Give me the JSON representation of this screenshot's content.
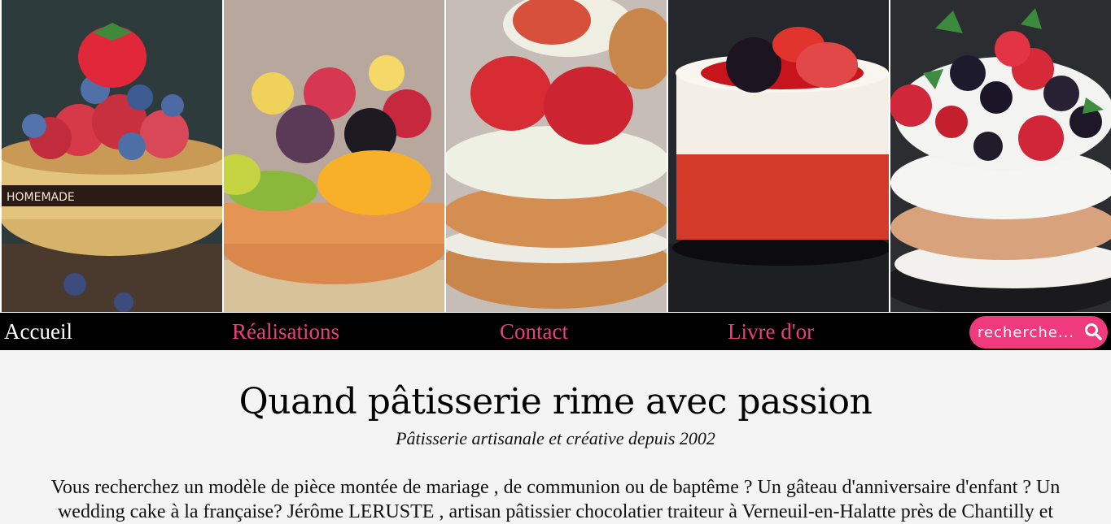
{
  "banner": {
    "photos": [
      {
        "name": "berry-tart-photo"
      },
      {
        "name": "fruit-tart-photo"
      },
      {
        "name": "strawberry-shortcake-photo"
      },
      {
        "name": "red-velvet-cake-photo"
      },
      {
        "name": "pavlova-photo"
      }
    ],
    "tart_label": "HOMEMADE"
  },
  "nav": {
    "items": [
      {
        "label": "Accueil",
        "active": true
      },
      {
        "label": "Réalisations",
        "active": false
      },
      {
        "label": "Contact",
        "active": false
      },
      {
        "label": "Livre d'or",
        "active": false
      }
    ],
    "search_placeholder": "recherche...",
    "search_icon": "search-icon"
  },
  "main": {
    "title": "Quand pâtisserie rime avec passion",
    "subtitle": "Pâtisserie artisanale et créative depuis 2002",
    "intro": "Vous recherchez un modèle de pièce montée de mariage , de communion ou de baptême ? Un gâteau d'anniversaire d'enfant ? Un wedding cake à la française? Jérôme LERUSTE , artisan pâtissier chocolatier traiteur à Verneuil-en-Halatte près de Chantilly et"
  },
  "colors": {
    "nav_bg": "#000000",
    "accent_pink": "#e8407f",
    "search_bg": "#f03a7e",
    "page_bg": "#f4f4f4"
  }
}
